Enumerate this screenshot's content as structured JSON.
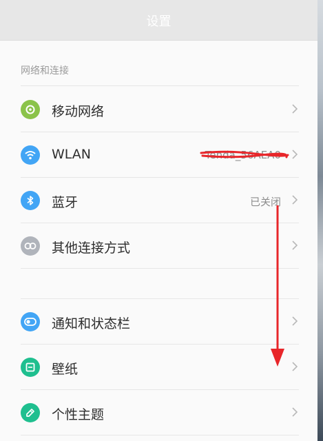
{
  "header": {
    "title": "设置"
  },
  "sections": {
    "network_label": "网络和连接"
  },
  "rows": {
    "mobile": {
      "label": "移动网络",
      "icon": "mobile-data-icon",
      "color": "#8bc34a"
    },
    "wlan": {
      "label": "WLAN",
      "value": "Tenda_56AEA0",
      "icon": "wifi-icon",
      "color": "#42a5f5"
    },
    "bluetooth": {
      "label": "蓝牙",
      "value": "已关闭",
      "icon": "bluetooth-icon",
      "color": "#42a5f5"
    },
    "other": {
      "label": "其他连接方式",
      "icon": "link-icon",
      "color": "#b0b4bb"
    },
    "notify": {
      "label": "通知和状态栏",
      "icon": "toggle-icon",
      "color": "#42a5f5"
    },
    "wallpaper": {
      "label": "壁纸",
      "icon": "wallpaper-icon",
      "color": "#1fbf8f"
    },
    "theme": {
      "label": "个性主题",
      "icon": "theme-brush-icon",
      "color": "#1fbf8f"
    }
  },
  "annotations": {
    "scribble_color": "#e8262a",
    "arrow_color": "#e8262a"
  }
}
